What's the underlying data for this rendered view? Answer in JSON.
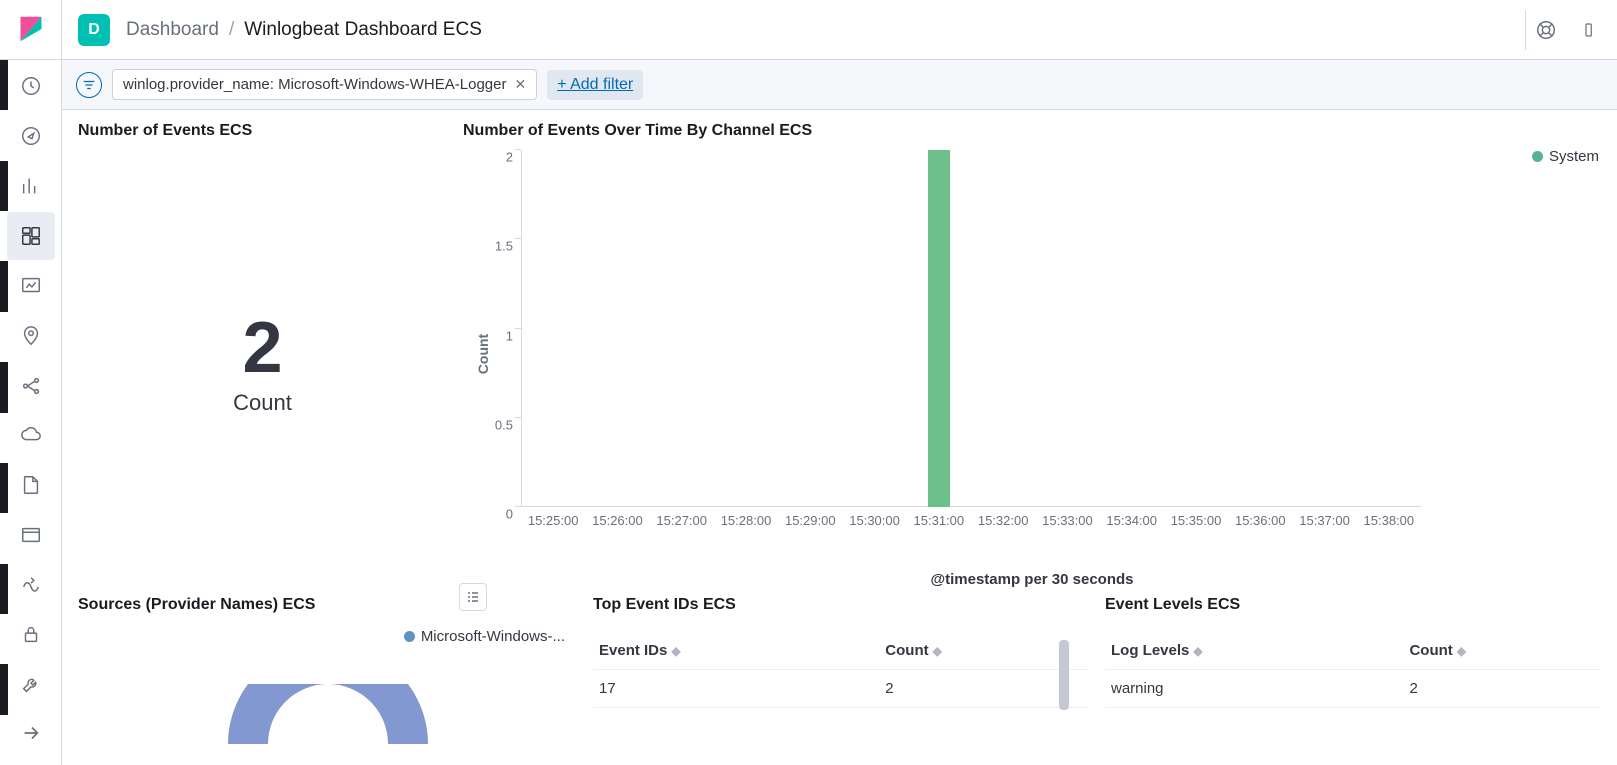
{
  "space_initial": "D",
  "breadcrumbs": {
    "root": "Dashboard",
    "current": "Winlogbeat Dashboard ECS"
  },
  "filter": {
    "pill_text": "winlog.provider_name: Microsoft-Windows-WHEA-Logger",
    "add_filter_label": "+ Add filter"
  },
  "metric": {
    "title": "Number of Events ECS",
    "value": "2",
    "label": "Count"
  },
  "chart": {
    "title": "Number of Events Over Time By Channel ECS",
    "legend_name": "System",
    "xlabel": "@timestamp per 30 seconds",
    "ylabel": "Count"
  },
  "sources": {
    "title": "Sources (Provider Names) ECS",
    "legend_name": "Microsoft-Windows-..."
  },
  "eventids": {
    "title": "Top Event IDs ECS",
    "col_id": "Event IDs",
    "col_count": "Count",
    "rows": [
      {
        "id": "17",
        "count": "2"
      }
    ]
  },
  "levels": {
    "title": "Event Levels ECS",
    "col_level": "Log Levels",
    "col_count": "Count",
    "rows": [
      {
        "level": "warning",
        "count": "2"
      }
    ]
  },
  "chart_data": {
    "type": "bar",
    "title": "Number of Events Over Time By Channel ECS",
    "xlabel": "@timestamp per 30 seconds",
    "ylabel": "Count",
    "ylim": [
      0,
      2
    ],
    "yticks": [
      0,
      0.5,
      1,
      1.5,
      2
    ],
    "categories": [
      "15:25:00",
      "15:26:00",
      "15:27:00",
      "15:28:00",
      "15:29:00",
      "15:30:00",
      "15:31:00",
      "15:32:00",
      "15:33:00",
      "15:34:00",
      "15:35:00",
      "15:36:00",
      "15:37:00",
      "15:38:00"
    ],
    "series": [
      {
        "name": "System",
        "color": "#6DBF8B",
        "values": [
          0,
          0,
          0,
          0,
          0,
          0,
          2,
          0,
          0,
          0,
          0,
          0,
          0,
          0
        ]
      }
    ]
  }
}
